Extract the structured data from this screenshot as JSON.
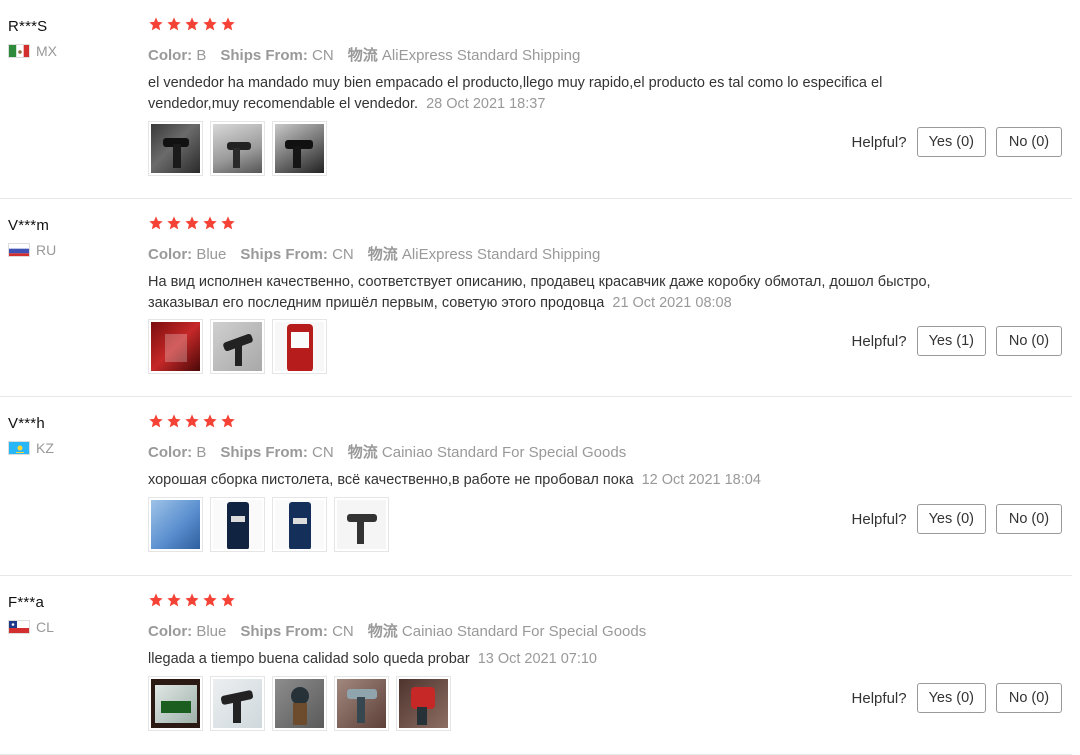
{
  "labels": {
    "color": "Color:",
    "ships_from": "Ships From:",
    "logistics": "物流",
    "helpful": "Helpful?"
  },
  "reviews": [
    {
      "user": "R***S",
      "country": "MX",
      "rating": 5,
      "color_value": "B",
      "ships_from_value": "CN",
      "logistics_value": "AliExpress Standard Shipping",
      "text": "el vendedor ha mandado muy bien empacado el producto,llego muy rapido,el producto es tal como lo especifica el vendedor,muy recomendable el vendedor.",
      "date": "28 Oct 2021 18:37",
      "yes": "Yes (0)",
      "no": "No (0)",
      "photos": 3
    },
    {
      "user": "V***m",
      "country": "RU",
      "rating": 5,
      "color_value": "Blue",
      "ships_from_value": "CN",
      "logistics_value": "AliExpress Standard Shipping",
      "text": "На вид исполнен качественно, соответствует описанию, продавец красавчик даже коробку обмотал, дошол быстро, заказывал его последним пришёл первым, советую этого продовца",
      "date": "21 Oct 2021 08:08",
      "yes": "Yes (1)",
      "no": "No (0)",
      "photos": 3
    },
    {
      "user": "V***h",
      "country": "KZ",
      "rating": 5,
      "color_value": "B",
      "ships_from_value": "CN",
      "logistics_value": "Cainiao Standard For Special Goods",
      "text": "хорошая сборка пистолета, всё качественно,в работе не пробовал пока",
      "date": "12 Oct 2021 18:04",
      "yes": "Yes (0)",
      "no": "No (0)",
      "photos": 4
    },
    {
      "user": "F***a",
      "country": "CL",
      "rating": 5,
      "color_value": "Blue",
      "ships_from_value": "CN",
      "logistics_value": "Cainiao Standard For Special Goods",
      "text": "llegada a tiempo buena calidad solo queda probar",
      "date": "13 Oct 2021 07:10",
      "yes": "Yes (0)",
      "no": "No (0)",
      "photos": 5
    }
  ],
  "colors": {
    "star": "#f44336",
    "muted": "#999999",
    "text": "#333333"
  },
  "icons": {
    "star": "star-icon",
    "flag": "country-flag-icon"
  }
}
